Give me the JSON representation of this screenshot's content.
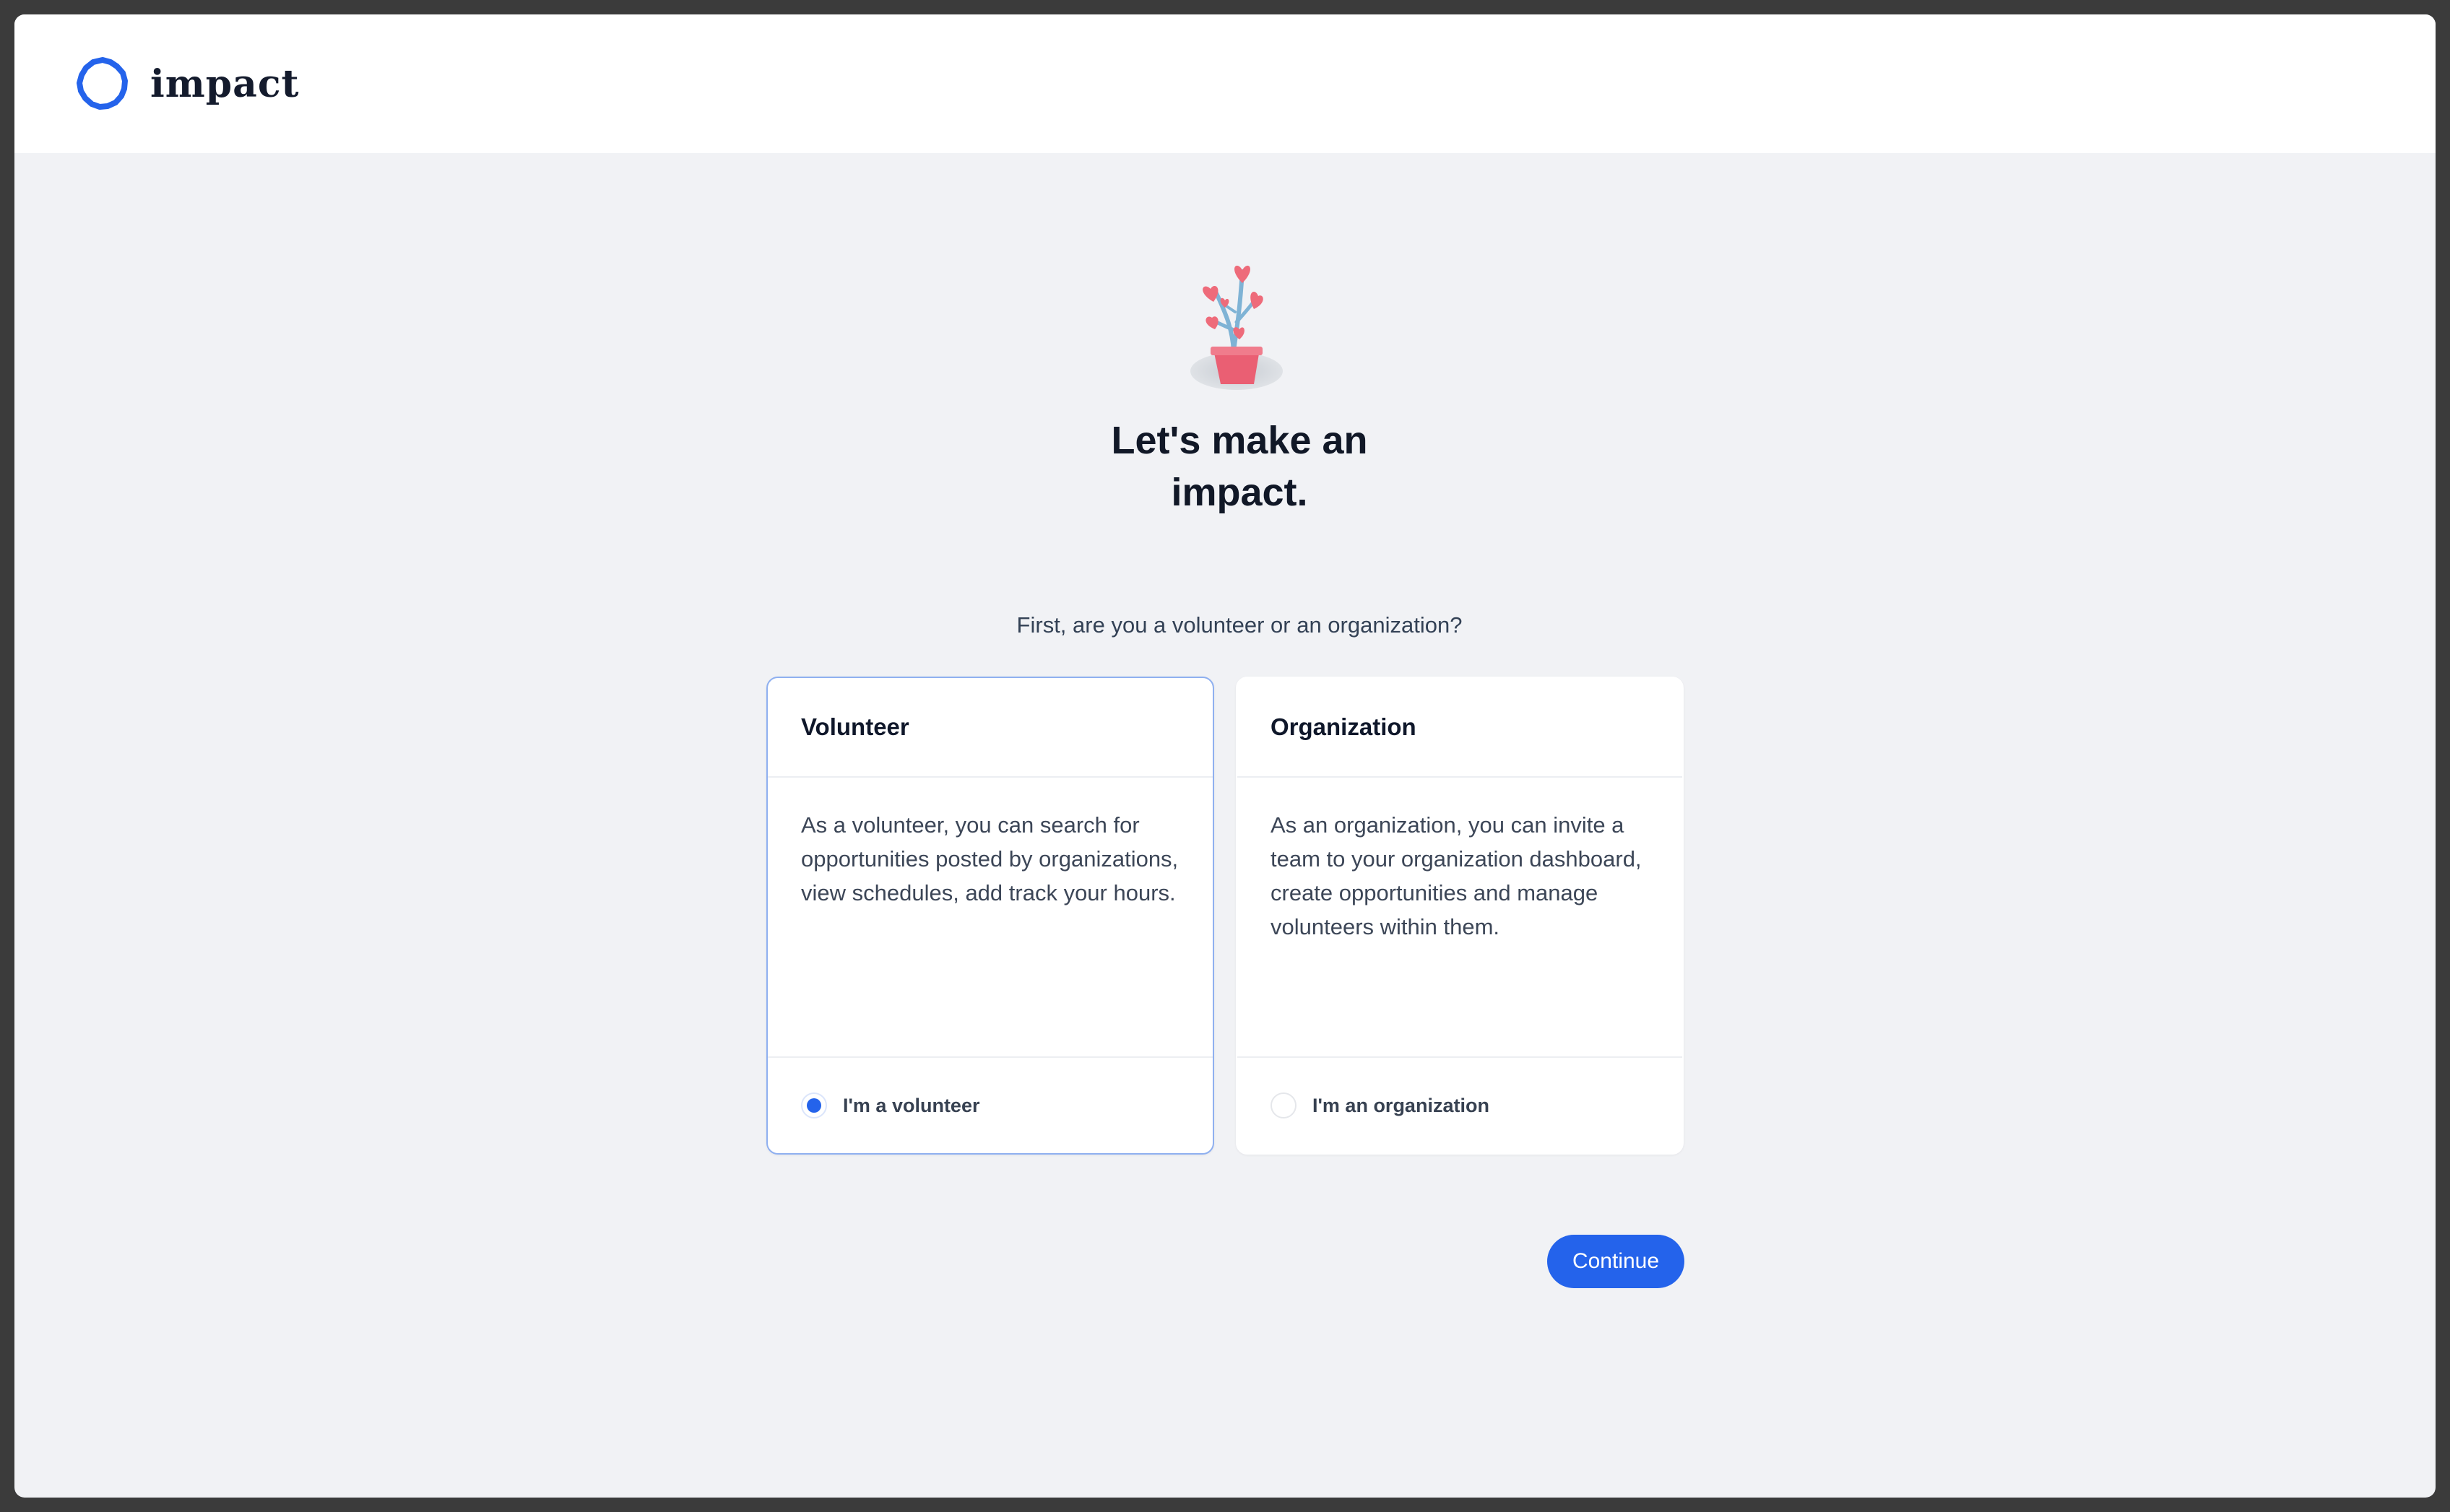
{
  "brand": {
    "name": "impact",
    "logo_icon": "ring-logo-icon",
    "accent_color": "#2463eb"
  },
  "hero": {
    "illustration_icon": "heart-plant-icon",
    "headline_line1": "Let's make an",
    "headline_line2": "impact."
  },
  "prompt": {
    "question": "First, are you a volunteer or an organization?"
  },
  "options": [
    {
      "title": "Volunteer",
      "description": "As a volunteer, you can search for opportunities posted by organizations, view schedules, add track your hours.",
      "radio_label": "I'm a volunteer",
      "selected": true
    },
    {
      "title": "Organization",
      "description": "As an organization, you can invite a team to your organization dashboard, create opportunities and manage volunteers within them.",
      "radio_label": "I'm an organization",
      "selected": false
    }
  ],
  "actions": {
    "continue_label": "Continue"
  }
}
